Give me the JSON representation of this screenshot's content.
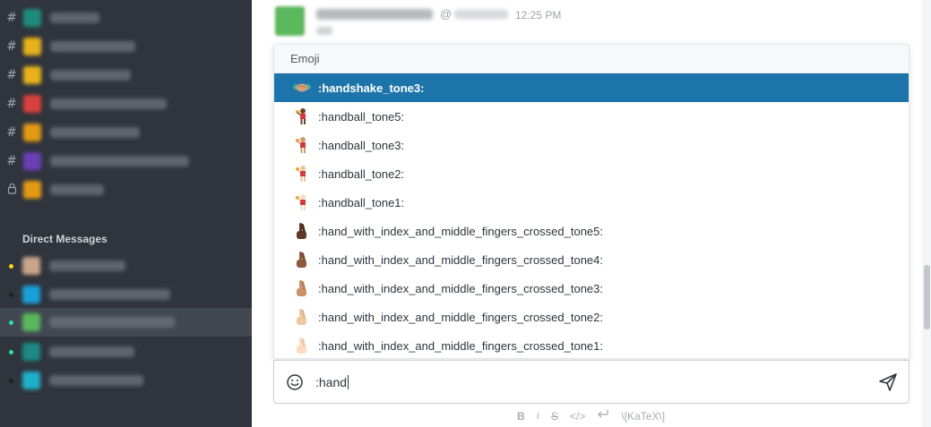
{
  "sidebar": {
    "direct_messages_title": "Direct Messages"
  },
  "message": {
    "at_sign": "@",
    "time": "12:25 PM"
  },
  "emoji_popup": {
    "title": "Emoji",
    "items": [
      ":handshake_tone3:",
      ":handball_tone5:",
      ":handball_tone3:",
      ":handball_tone2:",
      ":handball_tone1:",
      ":hand_with_index_and_middle_fingers_crossed_tone5:",
      ":hand_with_index_and_middle_fingers_crossed_tone4:",
      ":hand_with_index_and_middle_fingers_crossed_tone3:",
      ":hand_with_index_and_middle_fingers_crossed_tone2:",
      ":hand_with_index_and_middle_fingers_crossed_tone1:"
    ]
  },
  "composer": {
    "value": ":hand"
  },
  "format_bar": {
    "bold": "B",
    "italic": "i",
    "strike": "S",
    "code": "</>",
    "katex": "\\[KaTeX\\]"
  },
  "colors": {
    "sidebar_bg": "#2f343d",
    "selected_bg": "#1d74ab",
    "online": "#2de0a5",
    "away": "#ffd21f"
  },
  "icons": [
    "hash-icon",
    "lock-icon",
    "emoji-smile-icon",
    "send-icon",
    "enter-icon"
  ]
}
